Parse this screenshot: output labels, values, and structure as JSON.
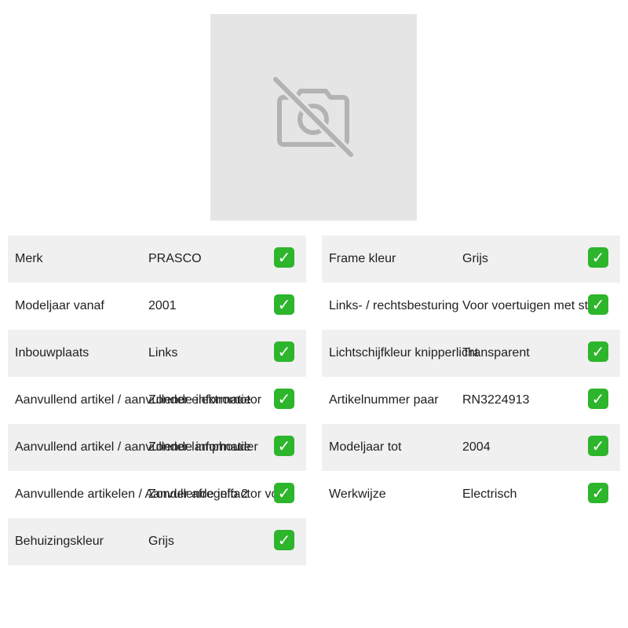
{
  "image_placeholder": {
    "icon": "no-camera-icon"
  },
  "left_specs": [
    {
      "label": "Merk",
      "value": "PRASCO",
      "status_icon": "check-mark-icon"
    },
    {
      "label": "Modeljaar vanaf",
      "value": "2001",
      "status_icon": "check-mark-icon"
    },
    {
      "label": "Inbouwplaats",
      "value": "Links",
      "status_icon": "check-mark-icon"
    },
    {
      "label": "Aanvullend artikel / aanvullende informatie",
      "value": "Zonder elektromotor",
      "status_icon": "check-mark-icon"
    },
    {
      "label": "Aanvullend artikel / aanvullende informatie",
      "value": "Zonder lamphouder",
      "status_icon": "check-mark-icon"
    },
    {
      "label": "Aanvullende artikelen / Aanvullende info 2",
      "value": "Zonder afregelfactor voor",
      "status_icon": "check-mark-icon"
    },
    {
      "label": "Behuizingskleur",
      "value": "Grijs",
      "status_icon": "check-mark-icon"
    }
  ],
  "right_specs": [
    {
      "label": "Frame kleur",
      "value": "Grijs",
      "status_icon": "check-mark-icon"
    },
    {
      "label": "Links- / rechtsbesturing",
      "value": "Voor voertuigen met stuur",
      "status_icon": "check-mark-icon"
    },
    {
      "label": "Lichtschijfkleur knipperlicht",
      "value": "Transparent",
      "status_icon": "check-mark-icon"
    },
    {
      "label": "Artikelnummer paar",
      "value": "RN3224913",
      "status_icon": "check-mark-icon"
    },
    {
      "label": "Modeljaar tot",
      "value": "2004",
      "status_icon": "check-mark-icon"
    },
    {
      "label": "Werkwijze",
      "value": "Electrisch",
      "status_icon": "check-mark-icon"
    }
  ],
  "colors": {
    "placeholder_bg": "#e5e5e5",
    "icon_gray": "#b3b3b3",
    "row_shade": "#f0f0f0",
    "check_green": "#2db52b"
  }
}
